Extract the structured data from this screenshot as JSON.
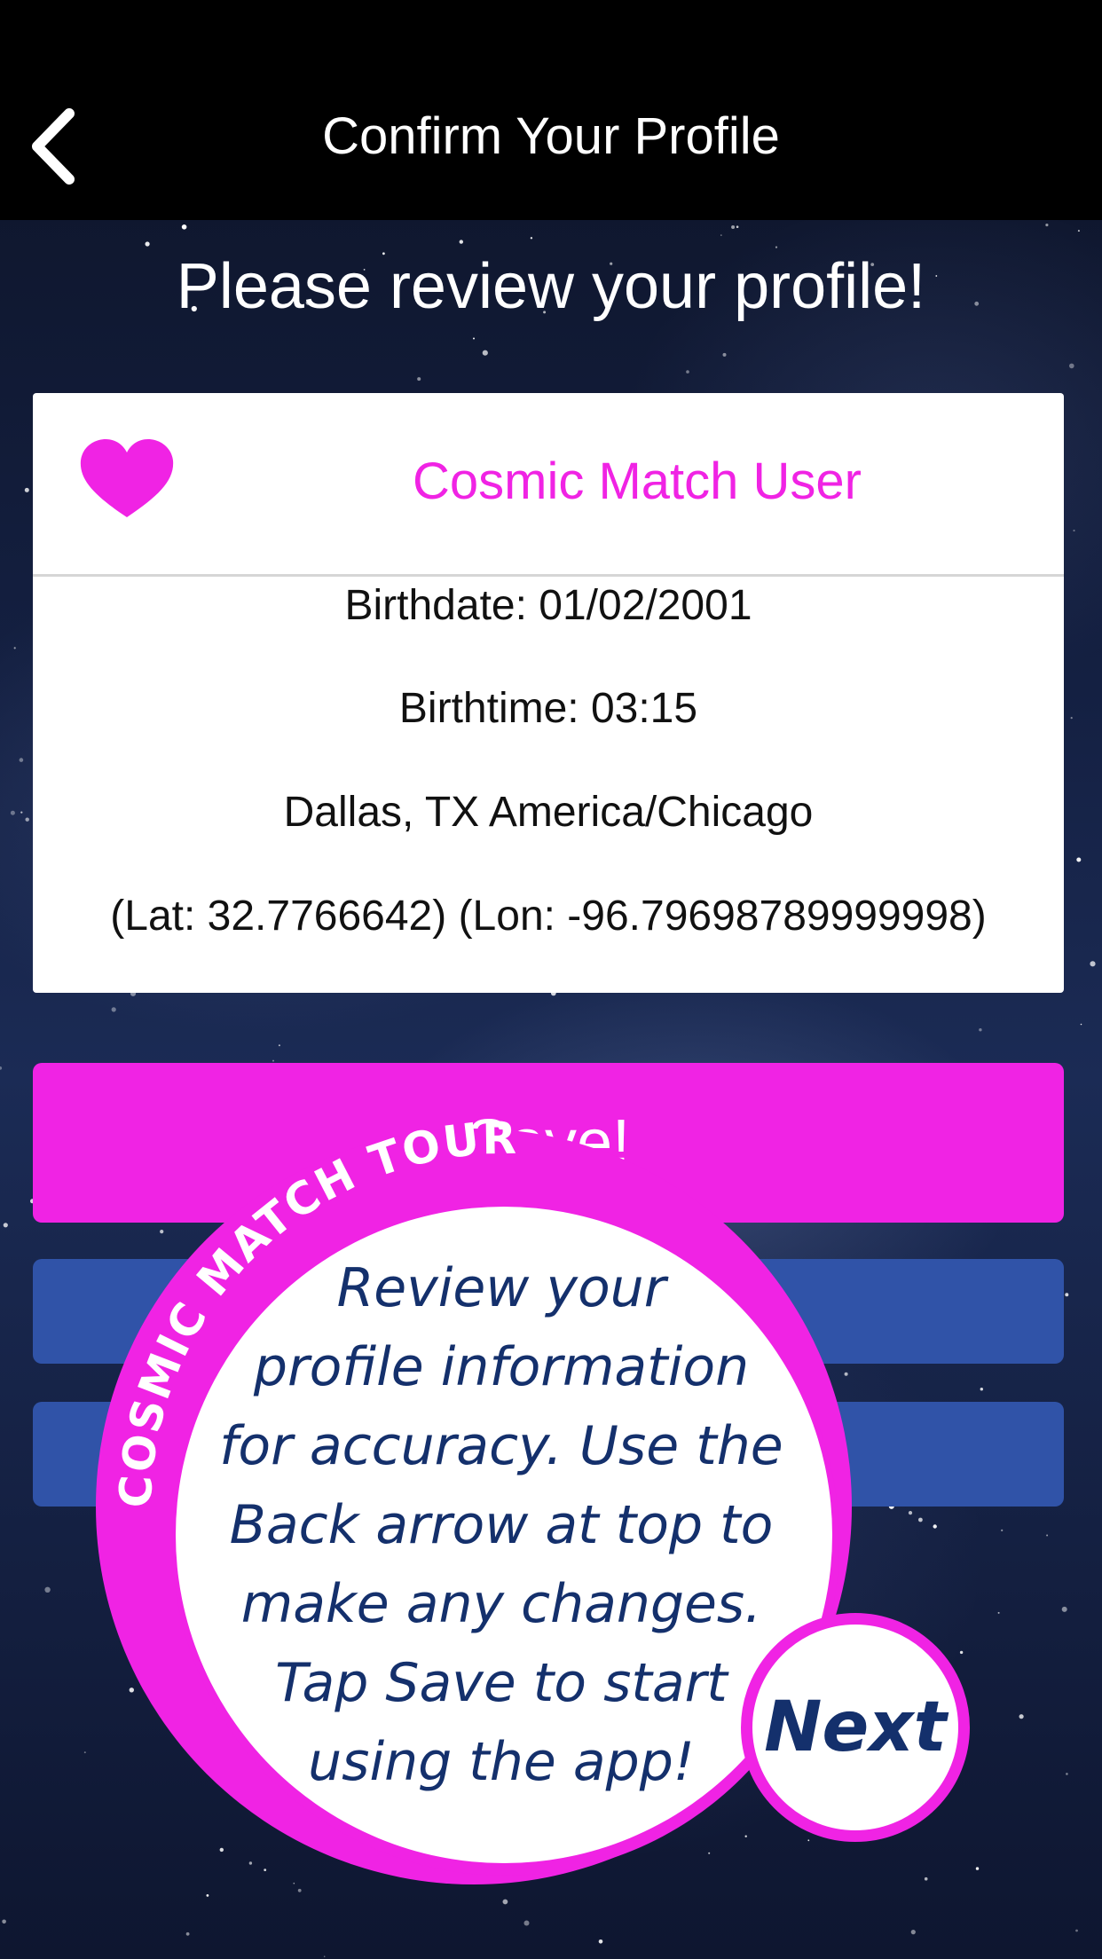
{
  "header": {
    "title": "Confirm Your Profile",
    "back_icon": "chevron-left-icon"
  },
  "subtitle": "Please review your profile!",
  "profile": {
    "icon": "heart-icon",
    "name": "Cosmic Match User",
    "birthdate": "Birthdate: 01/02/2001",
    "birthtime": "Birthtime: 03:15",
    "location": "Dallas, TX America/Chicago",
    "coordinates": "(Lat: 32.7766642) (Lon: -96.79698789999998)"
  },
  "actions": {
    "save_label": "Save!"
  },
  "tour": {
    "badge_label": "COSMIC MATCH TOUR",
    "message_lines": [
      "Review your",
      "profile information",
      "for accuracy. Use the",
      "Back arrow at top to",
      "make any changes.",
      "Tap Save to start",
      "using the app!"
    ],
    "next_label": "Next"
  },
  "colors": {
    "accent": "#f023e4",
    "button_blue": "#3053a8",
    "tour_text": "#14306c",
    "header_bg": "#000000"
  }
}
